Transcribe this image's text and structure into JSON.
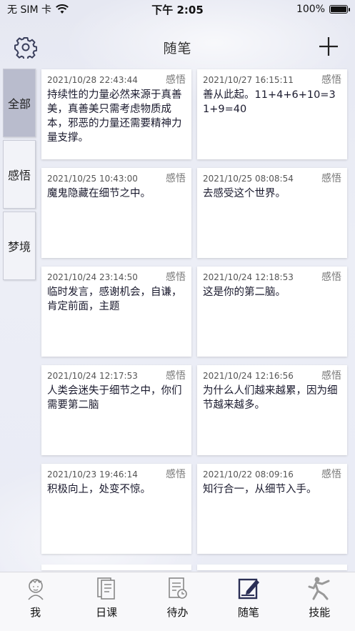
{
  "status_bar": {
    "carrier": "无 SIM 卡",
    "time": "下午 2:05",
    "battery": "100%"
  },
  "nav": {
    "title": "随笔",
    "settings_icon": "gear-icon",
    "add_icon": "plus-icon"
  },
  "side_tabs": [
    {
      "label": "全部",
      "active": true
    },
    {
      "label": "感悟",
      "active": false
    },
    {
      "label": "梦境",
      "active": false
    }
  ],
  "notes": [
    {
      "time": "2021/10/28 22:43:44",
      "category": "感悟",
      "text": "持续性的力量必然来源于真善美，真善美只需考虑物质成本，邪恶的力量还需要精神力量支撑。"
    },
    {
      "time": "2021/10/27 16:15:11",
      "category": "感悟",
      "text": "善从此起。11+4+6+10=31+9=40"
    },
    {
      "time": "2021/10/25 10:43:00",
      "category": "感悟",
      "text": "魔鬼隐藏在细节之中。"
    },
    {
      "time": "2021/10/25 08:08:54",
      "category": "感悟",
      "text": "去感受这个世界。"
    },
    {
      "time": "2021/10/24 23:14:50",
      "category": "感悟",
      "text": "临时发言，感谢机会，自谦，肯定前面，主题"
    },
    {
      "time": "2021/10/24 12:18:53",
      "category": "感悟",
      "text": "这是你的第二脑。"
    },
    {
      "time": "2021/10/24 12:17:53",
      "category": "感悟",
      "text": "人类会迷失于细节之中，你们需要第二脑"
    },
    {
      "time": "2021/10/24 12:16:56",
      "category": "感悟",
      "text": "为什么人们越来越累，因为细节越来越多。"
    },
    {
      "time": "2021/10/23 19:46:14",
      "category": "感悟",
      "text": "积极向上，处变不惊。"
    },
    {
      "time": "2021/10/22 08:09:16",
      "category": "感悟",
      "text": "知行合一，从细节入手。"
    }
  ],
  "tab_bar": [
    {
      "label": "我",
      "icon": "profile-avatar-icon",
      "active": false
    },
    {
      "label": "日课",
      "icon": "book-icon",
      "active": false
    },
    {
      "label": "待办",
      "icon": "todo-clock-icon",
      "active": false
    },
    {
      "label": "随笔",
      "icon": "edit-note-icon",
      "active": true
    },
    {
      "label": "技能",
      "icon": "martial-arts-icon",
      "active": false
    }
  ]
}
